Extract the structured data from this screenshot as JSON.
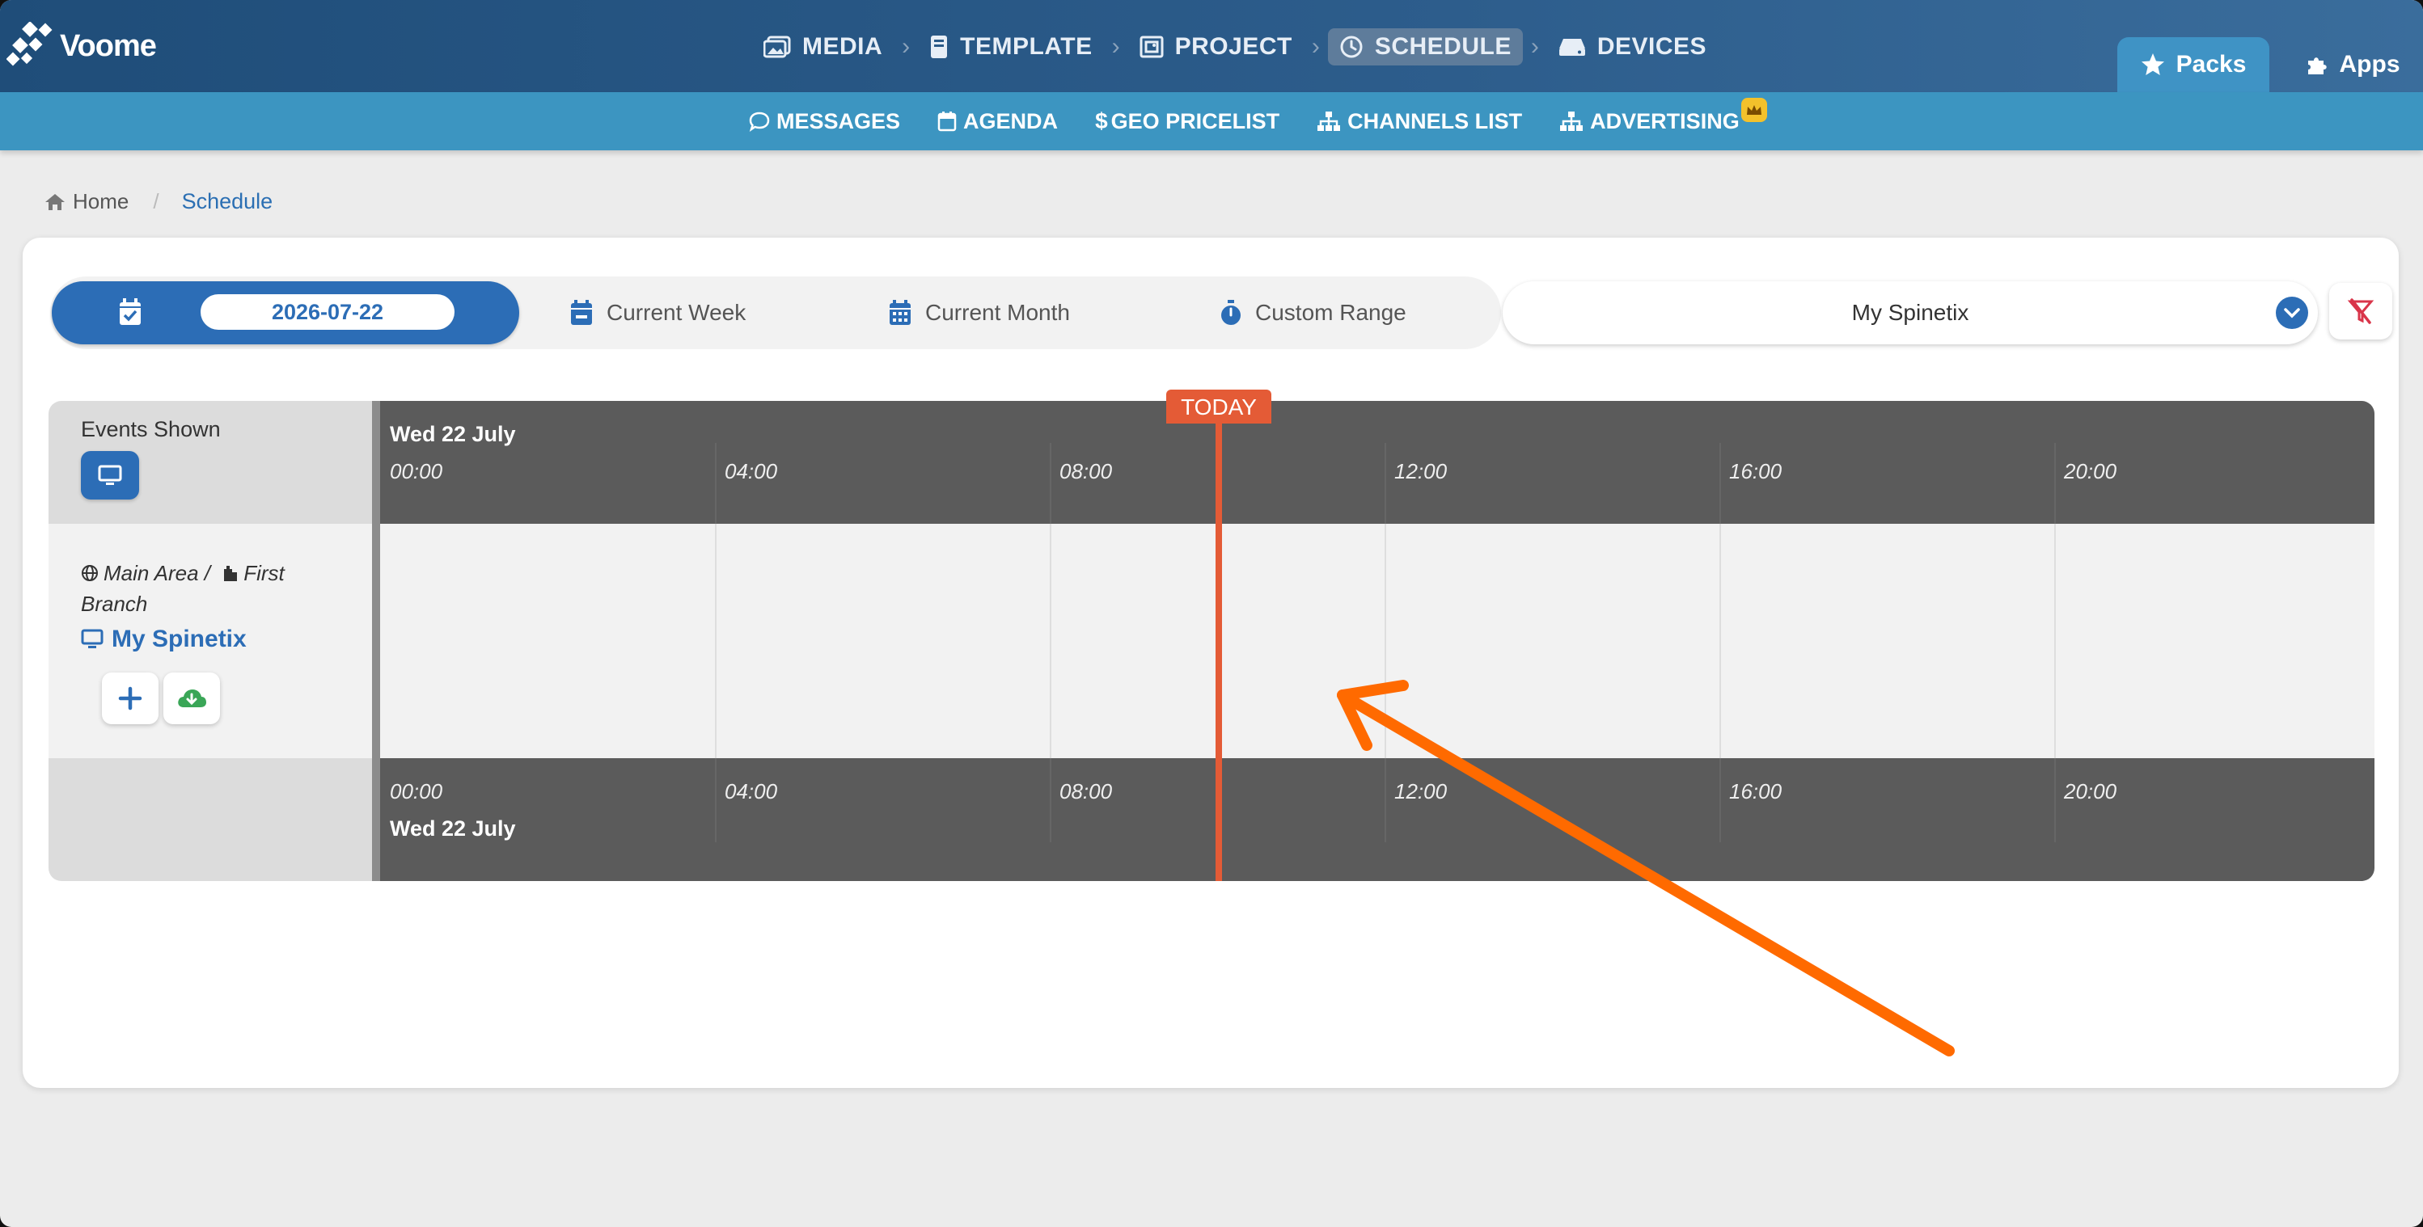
{
  "brand": {
    "name": "Voome"
  },
  "nav": {
    "steps": [
      {
        "label": "MEDIA",
        "icon": "images-icon"
      },
      {
        "label": "TEMPLATE",
        "icon": "book-icon"
      },
      {
        "label": "PROJECT",
        "icon": "project-icon"
      },
      {
        "label": "SCHEDULE",
        "icon": "clock-icon",
        "active": true
      },
      {
        "label": "DEVICES",
        "icon": "hdd-icon"
      }
    ],
    "packs_label": "Packs",
    "apps_label": "Apps"
  },
  "subnav": {
    "items": [
      {
        "label": "MESSAGES",
        "icon": "comment-icon"
      },
      {
        "label": "AGENDA",
        "icon": "calendar-icon"
      },
      {
        "label": "GEO PRICELIST",
        "icon": "dollar-icon"
      },
      {
        "label": "CHANNELS LIST",
        "icon": "sitemap-icon"
      },
      {
        "label": "ADVERTISING",
        "icon": "sitemap-icon",
        "badge": "crown-icon"
      }
    ]
  },
  "breadcrumb": {
    "home": "Home",
    "current": "Schedule"
  },
  "range": {
    "date_value": "2026-07-22",
    "week_label": "Current Week",
    "month_label": "Current Month",
    "custom_label": "Custom Range"
  },
  "device_select": {
    "value": "My Spinetix"
  },
  "timeline": {
    "events_shown_label": "Events Shown",
    "day_label": "Wed 22 July",
    "hours": [
      "00:00",
      "04:00",
      "08:00",
      "12:00",
      "16:00",
      "20:00"
    ],
    "today_label": "TODAY",
    "location_area": "Main Area /",
    "location_branch": "First Branch",
    "device_name": "My Spinetix"
  },
  "colors": {
    "primary": "#2c6db6",
    "topbar": "#1f4d79",
    "subbar": "#3c95c1",
    "today": "#e45b36",
    "annotation_arrow": "#ff6a00"
  }
}
